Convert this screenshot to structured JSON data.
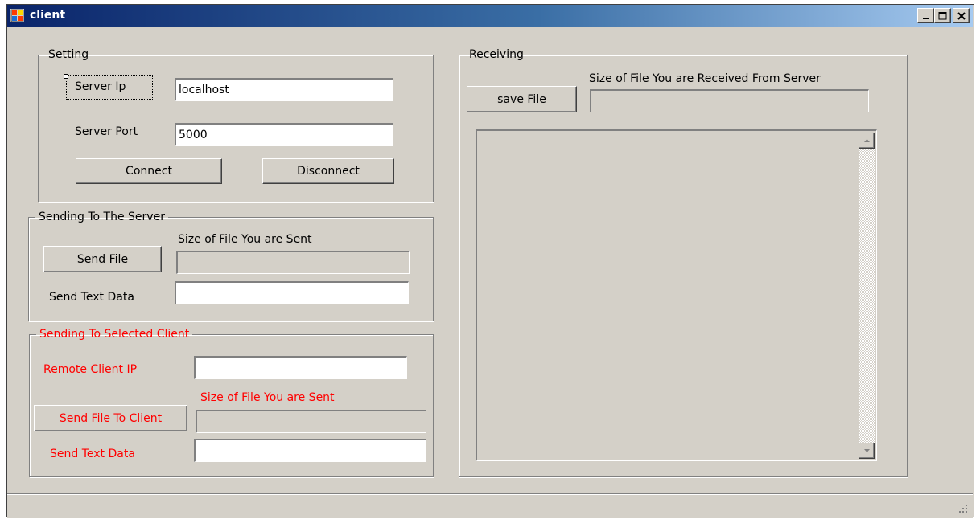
{
  "window": {
    "title": "client",
    "controls": [
      "minimize-icon",
      "maximize-icon",
      "close-icon"
    ]
  },
  "setting": {
    "legend": "Setting",
    "server_ip_label": "Server Ip",
    "server_ip_value": "localhost",
    "server_port_label": "Server Port",
    "server_port_value": "5000",
    "connect_label": "Connect",
    "disconnect_label": "Disconnect"
  },
  "sending_server": {
    "legend": "Sending  To The Server",
    "send_file_label": "Send File",
    "size_label": "Size of File You are Sent",
    "size_value": "",
    "send_text_label": "Send Text Data",
    "send_text_value": ""
  },
  "sending_client": {
    "legend": "Sending To Selected Client",
    "remote_ip_label": "Remote Client IP",
    "remote_ip_value": "",
    "size_label": "Size of File You are Sent",
    "size_value": "",
    "send_file_label": "Send File To Client",
    "send_text_label": "Send Text Data",
    "send_text_value": "",
    "label_color": "#ff0000"
  },
  "receiving": {
    "legend": "Receiving",
    "save_file_label": "save File",
    "size_label": "Size of File You are Received From Server",
    "size_value": "",
    "received_items": []
  },
  "colors": {
    "window_bg": "#d4d0c8",
    "titlebar_start": "#0a246a",
    "titlebar_end": "#a6caf0",
    "accent_red": "#ff0000"
  }
}
